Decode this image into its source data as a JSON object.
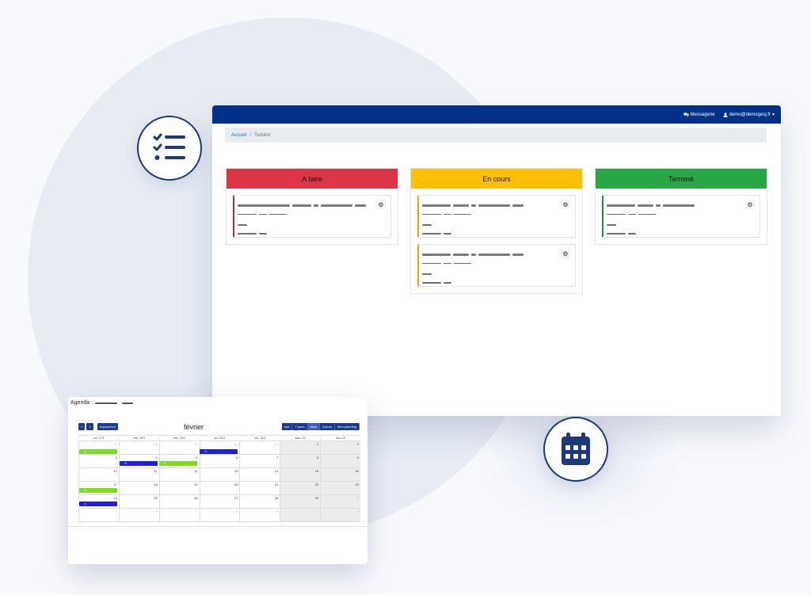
{
  "header": {
    "messagerie": "Messagerie",
    "user_email": "demo@demogesj.fr",
    "dropdown_caret": "▾"
  },
  "breadcrumb": {
    "home": "Accueil",
    "separator": "/",
    "current": "Todolist"
  },
  "columns": [
    {
      "title": "A faire",
      "color": "#dc3545",
      "cards": 1
    },
    {
      "title": "En cours",
      "color": "#ffc107",
      "cards": 2
    },
    {
      "title": "Terminé",
      "color": "#28a745",
      "cards": 1
    }
  ],
  "agenda": {
    "title": "Agenda :",
    "nav_prev": "<",
    "nav_next": ">",
    "today_label": "Aujourd'hui",
    "month": "février",
    "views": [
      "vue",
      "7 jours",
      "Mois",
      "3 jours",
      "Mon planning"
    ],
    "active_view": "Mois",
    "weekdays": [
      "lun. 27/1",
      "mar. 28/1",
      "mer. 29/1",
      "jeu. 30/1",
      "ven. 31/1",
      "sam. 1/2",
      "dim. 2/2"
    ],
    "weeks": [
      [
        "27",
        "28",
        "29",
        "30",
        "31",
        "1",
        "2"
      ],
      [
        "3",
        "4",
        "5",
        "6",
        "7",
        "8",
        "9"
      ],
      [
        "10",
        "11",
        "12",
        "13",
        "14",
        "15",
        "16"
      ],
      [
        "17",
        "18",
        "19",
        "20",
        "21",
        "22",
        "23"
      ],
      [
        "24",
        "25",
        "26",
        "27",
        "28",
        "29",
        "1"
      ],
      [
        "2",
        "3",
        "4",
        "5",
        "6",
        "7",
        "8"
      ]
    ],
    "event_icon": "⚠",
    "event_colors": {
      "green": "#7ddc1f",
      "blue": "#1e1edc"
    }
  },
  "icons": {
    "gear": "⚙",
    "messagerie_icon": "chat-icon",
    "user_icon": "user-icon",
    "todo_badge": "checklist-icon",
    "calendar_badge": "calendar-icon"
  }
}
